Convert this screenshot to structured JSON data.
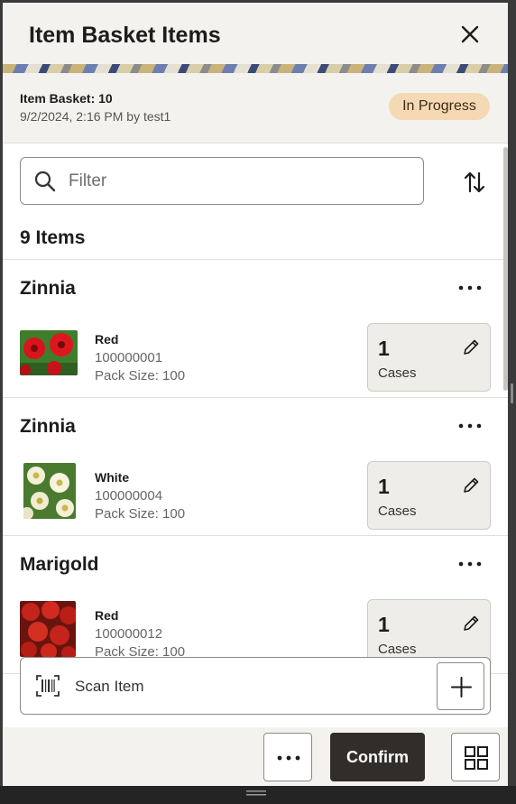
{
  "header": {
    "title": "Item Basket Items"
  },
  "summary": {
    "basket_name": "Item Basket: 10",
    "meta": "9/2/2024, 2:16 PM by test1",
    "status": "In Progress",
    "status_color": "#f5d9b5"
  },
  "filter": {
    "placeholder": "Filter"
  },
  "count_label": "9 Items",
  "items": [
    {
      "name": "Zinnia",
      "attribute": "Red",
      "code": "100000001",
      "pack": "Pack Size: 100",
      "qty": "1",
      "unit": "Cases",
      "thumb": "red-zinnia"
    },
    {
      "name": "Zinnia",
      "attribute": "White",
      "code": "100000004",
      "pack": "Pack Size: 100",
      "qty": "1",
      "unit": "Cases",
      "thumb": "white-zinnia"
    },
    {
      "name": "Marigold",
      "attribute": "Red",
      "code": "100000012",
      "pack": "Pack Size: 100",
      "qty": "1",
      "unit": "Cases",
      "thumb": "red-marigold"
    }
  ],
  "scan": {
    "label": "Scan Item"
  },
  "footer": {
    "confirm_label": "Confirm"
  },
  "colors": {
    "accent_dark": "#312d2a",
    "header_bg": "#f4f2ef"
  },
  "icons": [
    "close-icon",
    "search-icon",
    "sort-icon",
    "more-icon",
    "edit-icon",
    "barcode-icon",
    "plus-icon",
    "grid-icon"
  ]
}
